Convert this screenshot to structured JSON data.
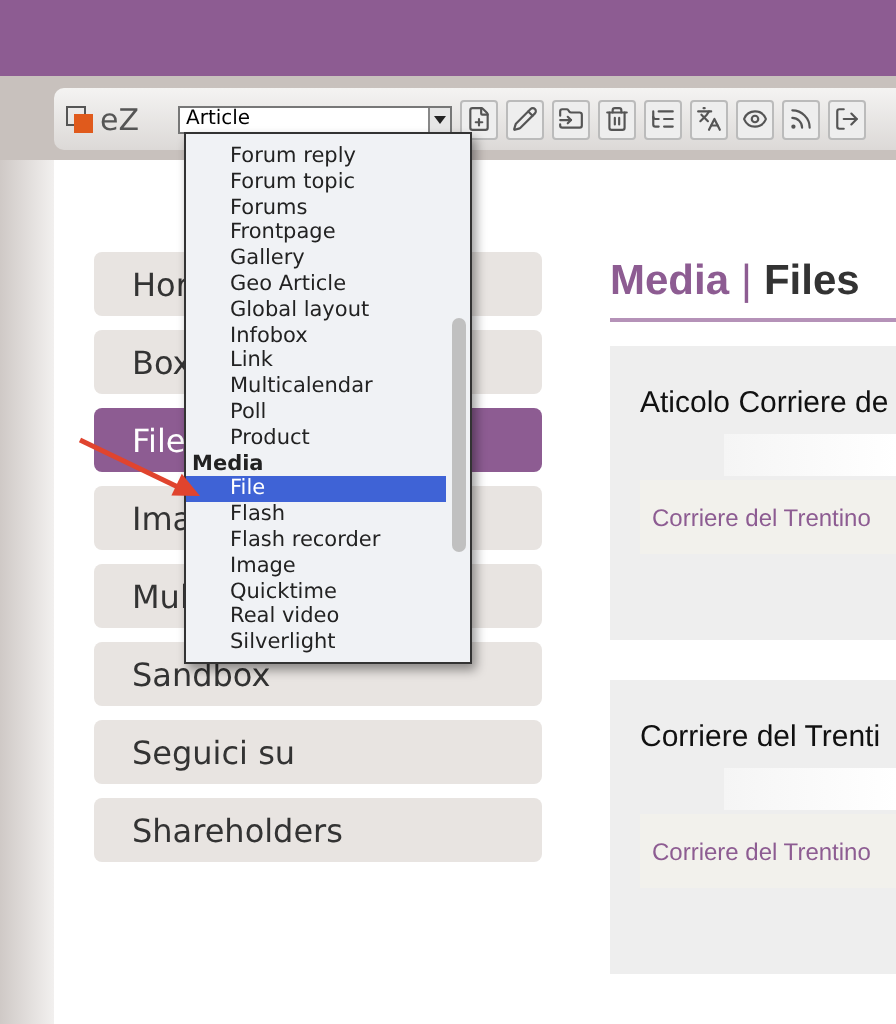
{
  "toolbar": {
    "logo": "eZ",
    "class_select": {
      "value": "Article"
    },
    "buttons": [
      {
        "kind": "new"
      },
      {
        "kind": "edit"
      },
      {
        "kind": "move"
      },
      {
        "kind": "remove"
      },
      {
        "kind": "sort"
      },
      {
        "kind": "translate"
      },
      {
        "kind": "preview"
      },
      {
        "kind": "rss"
      },
      {
        "kind": "export"
      }
    ]
  },
  "class_dropdown": {
    "items": [
      {
        "kind": "option",
        "label": "Forum reply",
        "selected": false
      },
      {
        "kind": "option",
        "label": "Forum topic",
        "selected": false
      },
      {
        "kind": "option",
        "label": "Forums",
        "selected": false
      },
      {
        "kind": "option",
        "label": "Frontpage",
        "selected": false
      },
      {
        "kind": "option",
        "label": "Gallery",
        "selected": false
      },
      {
        "kind": "option",
        "label": "Geo Article",
        "selected": false
      },
      {
        "kind": "option",
        "label": "Global layout",
        "selected": false
      },
      {
        "kind": "option",
        "label": "Infobox",
        "selected": false
      },
      {
        "kind": "option",
        "label": "Link",
        "selected": false
      },
      {
        "kind": "option",
        "label": "Multicalendar",
        "selected": false
      },
      {
        "kind": "option",
        "label": "Poll",
        "selected": false
      },
      {
        "kind": "option",
        "label": "Product",
        "selected": false
      },
      {
        "kind": "group",
        "label": "Media",
        "selected": false
      },
      {
        "kind": "option",
        "label": "File",
        "selected": true
      },
      {
        "kind": "option",
        "label": "Flash",
        "selected": false
      },
      {
        "kind": "option",
        "label": "Flash recorder",
        "selected": false
      },
      {
        "kind": "option",
        "label": "Image",
        "selected": false
      },
      {
        "kind": "option",
        "label": "Quicktime",
        "selected": false
      },
      {
        "kind": "option",
        "label": "Real video",
        "selected": false
      },
      {
        "kind": "option",
        "label": "Silverlight",
        "selected": false
      }
    ]
  },
  "sidebar": {
    "items": [
      {
        "label": "Hor",
        "selected": false
      },
      {
        "label": "Box",
        "selected": false
      },
      {
        "label": "File",
        "selected": true
      },
      {
        "label": "Ima",
        "selected": false
      },
      {
        "label": "Mul",
        "selected": false
      },
      {
        "label": "Sandbox",
        "selected": false
      },
      {
        "label": "Seguici su",
        "selected": false
      },
      {
        "label": "Shareholders",
        "selected": false
      }
    ]
  },
  "content": {
    "heading": {
      "section": "Media",
      "separator": "|",
      "title": "Files"
    },
    "cards": [
      {
        "title": "Aticolo Corriere de",
        "link": "Corriere del Trentino"
      },
      {
        "title": "Corriere del Trenti",
        "link": "Corriere del Trentino"
      }
    ]
  }
}
